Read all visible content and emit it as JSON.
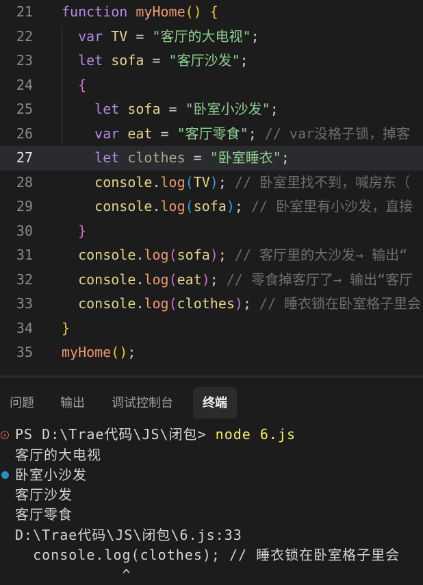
{
  "editor": {
    "active_line": 27,
    "lines": [
      {
        "n": "21",
        "tokens": [
          [
            "function",
            "kw"
          ],
          [
            " ",
            "p"
          ],
          [
            "myHome",
            "fn"
          ],
          [
            "(",
            "by"
          ],
          [
            ")",
            "by"
          ],
          [
            " ",
            "p"
          ],
          [
            "{",
            "by"
          ]
        ]
      },
      {
        "n": "22",
        "tokens": [
          [
            "  ",
            "p"
          ],
          [
            "var",
            "kw"
          ],
          [
            " ",
            "p"
          ],
          [
            "TV",
            "var"
          ],
          [
            " = ",
            "p"
          ],
          [
            "\"客厅的大电视\"",
            "str"
          ],
          [
            ";",
            "p"
          ]
        ]
      },
      {
        "n": "23",
        "tokens": [
          [
            "  ",
            "p"
          ],
          [
            "let",
            "kw"
          ],
          [
            " ",
            "p"
          ],
          [
            "sofa",
            "var"
          ],
          [
            " = ",
            "p"
          ],
          [
            "\"客厅沙发\"",
            "str"
          ],
          [
            ";",
            "p"
          ]
        ]
      },
      {
        "n": "24",
        "tokens": [
          [
            "  ",
            "p"
          ],
          [
            "{",
            "bp"
          ]
        ]
      },
      {
        "n": "25",
        "tokens": [
          [
            "    ",
            "p"
          ],
          [
            "let",
            "kw"
          ],
          [
            " ",
            "p"
          ],
          [
            "sofa",
            "var"
          ],
          [
            " = ",
            "p"
          ],
          [
            "\"卧室小沙发\"",
            "str"
          ],
          [
            ";",
            "p"
          ]
        ]
      },
      {
        "n": "26",
        "tokens": [
          [
            "    ",
            "p"
          ],
          [
            "var",
            "kw"
          ],
          [
            " ",
            "p"
          ],
          [
            "eat",
            "var"
          ],
          [
            " = ",
            "p"
          ],
          [
            "\"客厅零食\"",
            "str"
          ],
          [
            ";",
            "p"
          ],
          [
            " // var没格子锁，掉客",
            "cm"
          ]
        ]
      },
      {
        "n": "27",
        "tokens": [
          [
            "    ",
            "p"
          ],
          [
            "let",
            "kw"
          ],
          [
            " ",
            "p"
          ],
          [
            "clothes",
            "dim"
          ],
          [
            " = ",
            "p"
          ],
          [
            "\"卧室睡衣\"",
            "str"
          ],
          [
            ";",
            "p"
          ]
        ]
      },
      {
        "n": "28",
        "tokens": [
          [
            "    ",
            "p"
          ],
          [
            "console",
            "var"
          ],
          [
            ".",
            "p"
          ],
          [
            "log",
            "mth"
          ],
          [
            "(",
            "bb"
          ],
          [
            "TV",
            "var"
          ],
          [
            ")",
            "bb"
          ],
          [
            ";",
            "p"
          ],
          [
            " // 卧室里找不到，喊房东（",
            "cm"
          ]
        ]
      },
      {
        "n": "29",
        "tokens": [
          [
            "    ",
            "p"
          ],
          [
            "console",
            "var"
          ],
          [
            ".",
            "p"
          ],
          [
            "log",
            "mth"
          ],
          [
            "(",
            "bb"
          ],
          [
            "sofa",
            "var"
          ],
          [
            ")",
            "bb"
          ],
          [
            ";",
            "p"
          ],
          [
            " // 卧室里有小沙发，直接",
            "cm"
          ]
        ]
      },
      {
        "n": "30",
        "tokens": [
          [
            "  ",
            "p"
          ],
          [
            "}",
            "bp"
          ]
        ]
      },
      {
        "n": "31",
        "tokens": [
          [
            "  ",
            "p"
          ],
          [
            "console",
            "var"
          ],
          [
            ".",
            "p"
          ],
          [
            "log",
            "mth"
          ],
          [
            "(",
            "bp"
          ],
          [
            "sofa",
            "var"
          ],
          [
            ")",
            "bp"
          ],
          [
            ";",
            "p"
          ],
          [
            " // 客厅里的大沙发→ 输出“",
            "cm"
          ]
        ]
      },
      {
        "n": "32",
        "tokens": [
          [
            "  ",
            "p"
          ],
          [
            "console",
            "var"
          ],
          [
            ".",
            "p"
          ],
          [
            "log",
            "mth"
          ],
          [
            "(",
            "bp"
          ],
          [
            "eat",
            "var"
          ],
          [
            ")",
            "bp"
          ],
          [
            ";",
            "p"
          ],
          [
            " // 零食掉客厅了→ 输出“客厅",
            "cm"
          ]
        ]
      },
      {
        "n": "33",
        "tokens": [
          [
            "  ",
            "p"
          ],
          [
            "console",
            "var"
          ],
          [
            ".",
            "p"
          ],
          [
            "log",
            "mth"
          ],
          [
            "(",
            "bp"
          ],
          [
            "clothes",
            "var"
          ],
          [
            ")",
            "bp"
          ],
          [
            ";",
            "p"
          ],
          [
            " // 睡衣锁在卧室格子里会",
            "cm"
          ]
        ]
      },
      {
        "n": "34",
        "tokens": [
          [
            "}",
            "by"
          ]
        ]
      },
      {
        "n": "35",
        "tokens": [
          [
            "myHome",
            "fn"
          ],
          [
            "(",
            "by"
          ],
          [
            ")",
            "by"
          ],
          [
            ";",
            "p"
          ]
        ]
      }
    ]
  },
  "panel": {
    "tabs": [
      "问题",
      "输出",
      "调试控制台",
      "终端"
    ],
    "active_tab": "终端"
  },
  "terminal": {
    "prompt": "PS D:\\Trae代码\\JS\\闭包> ",
    "command": "node 6.js",
    "output": [
      "客厅的大电视",
      "卧室小沙发",
      "客厅沙发",
      "客厅零食",
      "D:\\Trae代码\\JS\\闭包\\6.js:33",
      "  console.log(clothes); // 睡衣锁在卧室格子里会",
      "            ^"
    ]
  }
}
